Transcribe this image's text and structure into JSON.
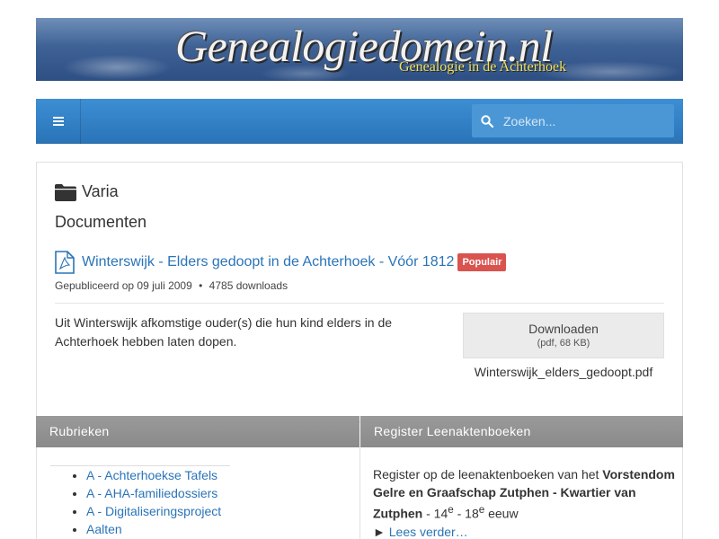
{
  "header": {
    "site_title": "Genealogiedomein.nl",
    "site_subtitle": "Genealogie in de Achterhoek"
  },
  "navbar": {
    "menu_icon": "hamburger-icon",
    "search_icon": "search-icon",
    "search_placeholder": "Zoeken...",
    "search_value": ""
  },
  "main": {
    "category_icon": "folder-icon",
    "category": "Varia",
    "section_title": "Documenten",
    "document": {
      "file_icon": "pdf-file-icon",
      "title": "Winterswijk - Elders gedoopt in de Achterhoek - Vóór 1812",
      "badge": "Populair",
      "published": "Gepubliceerd op 09 juli 2009",
      "separator": "•",
      "downloads": "4785 downloads",
      "description": "Uit Winterswijk afkomstige ouder(s) die hun kind elders in de Achterhoek hebben laten dopen.",
      "download_label": "Downloaden",
      "download_info": "(pdf, 68 KB)",
      "filename": "Winterswijk_elders_gedoopt.pdf"
    }
  },
  "panels": {
    "left": {
      "title": "Rubrieken",
      "items": [
        "A - Achterhoekse Tafels",
        "A - AHA-familiedossiers",
        "A - Digitaliseringsproject",
        "Aalten"
      ]
    },
    "right": {
      "title": "Register Leenaktenboeken",
      "text_before": "Register op de leenaktenboeken van het ",
      "bold_text": "Vorstendom Gelre en Graafschap Zutphen - Kwartier van Zutphen",
      "text_dash": " - 14",
      "sup1": "e",
      "text_mid": " - 18",
      "sup2": "e",
      "text_after": " eeuw",
      "arrow": "►",
      "read_more": "Lees verder…"
    }
  },
  "colors": {
    "primary": "#2a74b8",
    "badge": "#d9534f",
    "panel_header": "#8f8f8f"
  }
}
